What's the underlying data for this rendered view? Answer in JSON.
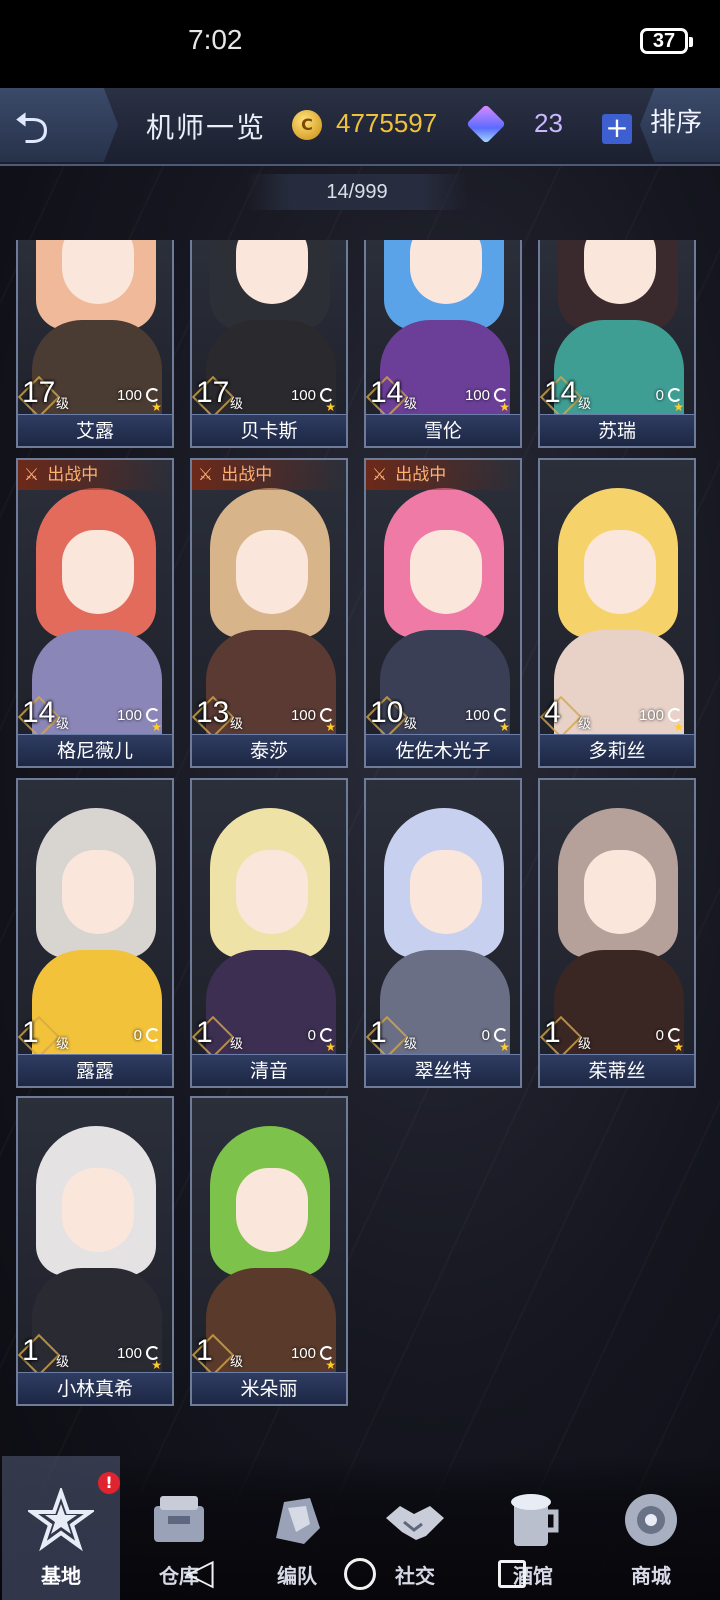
{
  "status_bar": {
    "time": "7:02",
    "battery": "37"
  },
  "header": {
    "title": "机师一览",
    "coins": "4775597",
    "gems": "23",
    "plus_label": "+",
    "sort_label": "排序",
    "coin_icon": "coin-icon",
    "gem_icon": "gem-icon"
  },
  "count_display": "14/999",
  "deploy_label": "出战中",
  "level_suffix": "级",
  "pilots": [
    {
      "name": "艾露",
      "level": "17",
      "exp": "100",
      "deployed": false,
      "hair": "#f0b99a",
      "body": "#4a3b33"
    },
    {
      "name": "贝卡斯",
      "level": "17",
      "exp": "100",
      "deployed": false,
      "hair": "#2d2f36",
      "body": "#2a2a2e"
    },
    {
      "name": "雪伦",
      "level": "14",
      "exp": "100",
      "deployed": false,
      "hair": "#5aa3e8",
      "body": "#6b3f98"
    },
    {
      "name": "苏瑞",
      "level": "14",
      "exp": "0",
      "deployed": false,
      "hair": "#3a2a2e",
      "body": "#3f9e93"
    },
    {
      "name": "格尼薇儿",
      "level": "14",
      "exp": "100",
      "deployed": true,
      "hair": "#e36b5c",
      "body": "#8a86b8"
    },
    {
      "name": "泰莎",
      "level": "13",
      "exp": "100",
      "deployed": true,
      "hair": "#d8b48a",
      "body": "#5a3a33"
    },
    {
      "name": "佐佐木光子",
      "level": "10",
      "exp": "100",
      "deployed": true,
      "hair": "#f07aa6",
      "body": "#3a3f55"
    },
    {
      "name": "多莉丝",
      "level": "4",
      "exp": "100",
      "deployed": false,
      "hair": "#f6d36a",
      "body": "#e8d2c8"
    },
    {
      "name": "露露",
      "level": "1",
      "exp": "0",
      "deployed": false,
      "hair": "#d8d4d0",
      "body": "#f2c23a"
    },
    {
      "name": "清音",
      "level": "1",
      "exp": "0",
      "deployed": false,
      "hair": "#efe2a6",
      "body": "#3d2f52"
    },
    {
      "name": "翠丝特",
      "level": "1",
      "exp": "0",
      "deployed": false,
      "hair": "#c8d0f0",
      "body": "#6a6f85"
    },
    {
      "name": "茱蒂丝",
      "level": "1",
      "exp": "0",
      "deployed": false,
      "hair": "#b6a09a",
      "body": "#3a2623"
    },
    {
      "name": "小林真希",
      "level": "1",
      "exp": "100",
      "deployed": false,
      "hair": "#e4e2e2",
      "body": "#2a2a33"
    },
    {
      "name": "米朵丽",
      "level": "1",
      "exp": "100",
      "deployed": false,
      "hair": "#7dc24a",
      "body": "#5a3a2a"
    }
  ],
  "bottom_nav": [
    {
      "label": "基地",
      "icon": "base-icon",
      "active": true,
      "badge": "!"
    },
    {
      "label": "仓库",
      "icon": "warehouse-icon",
      "active": false
    },
    {
      "label": "编队",
      "icon": "formation-icon",
      "active": false
    },
    {
      "label": "社交",
      "icon": "handshake-icon",
      "active": false
    },
    {
      "label": "酒馆",
      "icon": "tavern-icon",
      "active": false
    },
    {
      "label": "商城",
      "icon": "shop-icon",
      "active": false
    }
  ],
  "colors": {
    "accent_gold": "#f0c23c",
    "gem_text": "#c8b8ff",
    "deploy": "#ffb070",
    "badge": "#e0242f"
  }
}
